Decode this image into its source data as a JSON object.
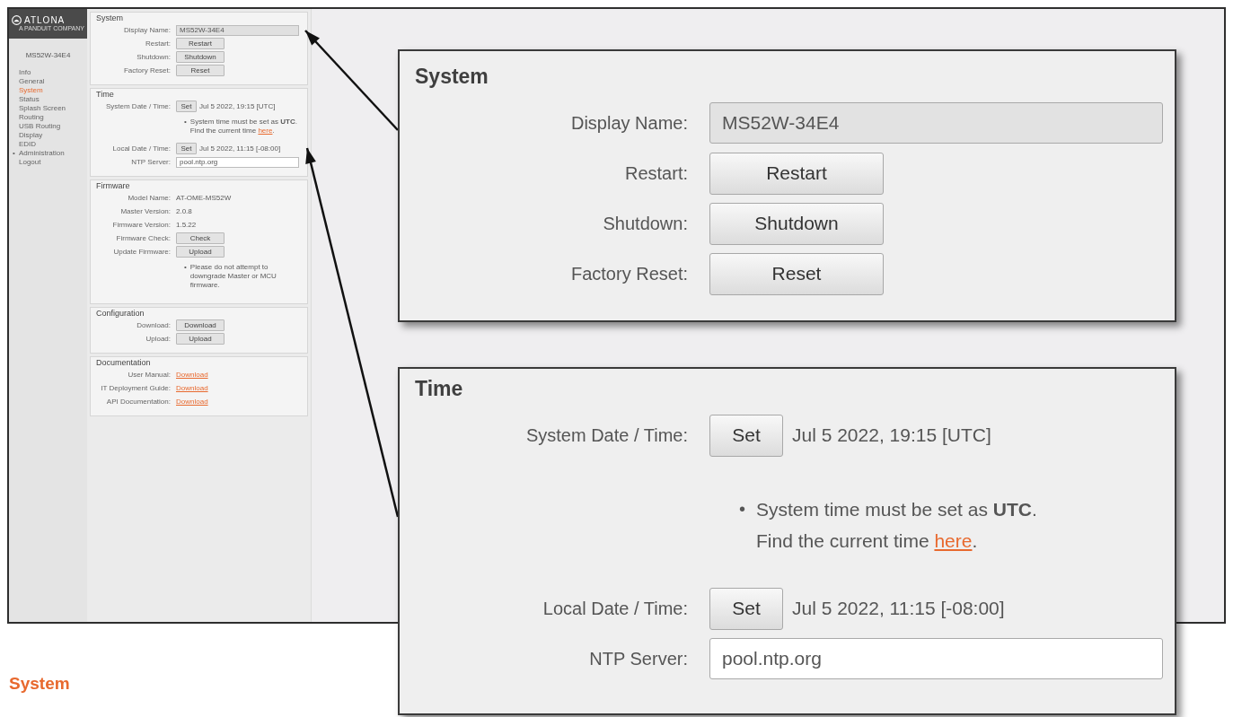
{
  "frame": {
    "sidebar": {
      "logo": {
        "name": "ATLONA",
        "tagline": "A PANDUIT COMPANY"
      },
      "device_name": "MS52W-34E4",
      "items": [
        {
          "label": "Info",
          "selected": false
        },
        {
          "label": "General",
          "selected": false
        },
        {
          "label": "System",
          "selected": true
        },
        {
          "label": "Status",
          "selected": false
        },
        {
          "label": "Splash Screen",
          "selected": false
        },
        {
          "label": "Routing",
          "selected": false
        },
        {
          "label": "USB Routing",
          "selected": false
        },
        {
          "label": "Display",
          "selected": false
        },
        {
          "label": "EDID",
          "selected": false
        },
        {
          "label": "Administration",
          "selected": false,
          "marker": "•"
        },
        {
          "label": "Logout",
          "selected": false
        }
      ]
    },
    "sections": [
      {
        "title": "System",
        "rows": [
          {
            "kind": "input",
            "label": "Display Name:",
            "value": "MS52W-34E4",
            "disabled": true
          },
          {
            "kind": "button",
            "label": "Restart:",
            "button": "Restart"
          },
          {
            "kind": "button",
            "label": "Shutdown:",
            "button": "Shutdown"
          },
          {
            "kind": "button",
            "label": "Factory Reset:",
            "button": "Reset"
          }
        ]
      },
      {
        "title": "Time",
        "rows": [
          {
            "kind": "set",
            "label": "System Date / Time:",
            "button": "Set",
            "value": "Jul 5 2022, 19:15 [UTC]"
          },
          {
            "kind": "note",
            "bullet": "•",
            "lines": [
              {
                "text": "System time must be set as **UTC**."
              },
              {
                "text": "Find the current time ",
                "link": "here",
                "after": "."
              }
            ]
          },
          {
            "kind": "set",
            "label": "Local Date / Time:",
            "button": "Set",
            "value": "Jul 5 2022, 11:15 [-08:00]"
          },
          {
            "kind": "input",
            "label": "NTP Server:",
            "value": "pool.ntp.org",
            "disabled": false
          }
        ]
      },
      {
        "title": "Firmware",
        "rows": [
          {
            "kind": "text",
            "label": "Model Name:",
            "value": "AT-OME-MS52W"
          },
          {
            "kind": "text",
            "label": "Master Version:",
            "value": "2.0.8"
          },
          {
            "kind": "text",
            "label": "Firmware Version:",
            "value": "1.5.22"
          },
          {
            "kind": "button",
            "label": "Firmware Check:",
            "button": "Check"
          },
          {
            "kind": "button",
            "label": "Update Firmware:",
            "button": "Upload"
          },
          {
            "kind": "note",
            "bullet": "•",
            "lines": [
              {
                "text": "Please do not attempt to downgrade Master or MCU firmware."
              }
            ]
          }
        ]
      },
      {
        "title": "Configuration",
        "rows": [
          {
            "kind": "button",
            "label": "Download:",
            "button": "Download"
          },
          {
            "kind": "button",
            "label": "Upload:",
            "button": "Upload"
          }
        ]
      },
      {
        "title": "Documentation",
        "rows": [
          {
            "kind": "link",
            "label": "User Manual:",
            "link": "Download"
          },
          {
            "kind": "link",
            "label": "IT Deployment Guide:",
            "link": "Download"
          },
          {
            "kind": "link",
            "label": "API Documentation:",
            "link": "Download"
          }
        ]
      }
    ]
  },
  "callouts": [
    {
      "title": "System",
      "rows": [
        {
          "kind": "input",
          "label": "Display Name:",
          "value": "MS52W-34E4",
          "disabled": true
        },
        {
          "kind": "button",
          "label": "Restart:",
          "button": "Restart"
        },
        {
          "kind": "button",
          "label": "Shutdown:",
          "button": "Shutdown"
        },
        {
          "kind": "button",
          "label": "Factory Reset:",
          "button": "Reset"
        }
      ]
    },
    {
      "title": "Time",
      "rows": [
        {
          "kind": "set",
          "label": "System Date / Time:",
          "button": "Set",
          "value": "Jul 5 2022, 19:15 [UTC]"
        },
        {
          "kind": "note",
          "bullet": "•",
          "lines": [
            {
              "text": "System time must be set as **UTC**."
            },
            {
              "text": "Find the current time ",
              "link": "here",
              "after": "."
            }
          ]
        },
        {
          "kind": "set",
          "label": "Local Date / Time:",
          "button": "Set",
          "value": "Jul 5 2022, 11:15 [-08:00]"
        },
        {
          "kind": "input",
          "label": "NTP Server:",
          "value": "pool.ntp.org",
          "disabled": false
        }
      ]
    }
  ],
  "caption": "System"
}
